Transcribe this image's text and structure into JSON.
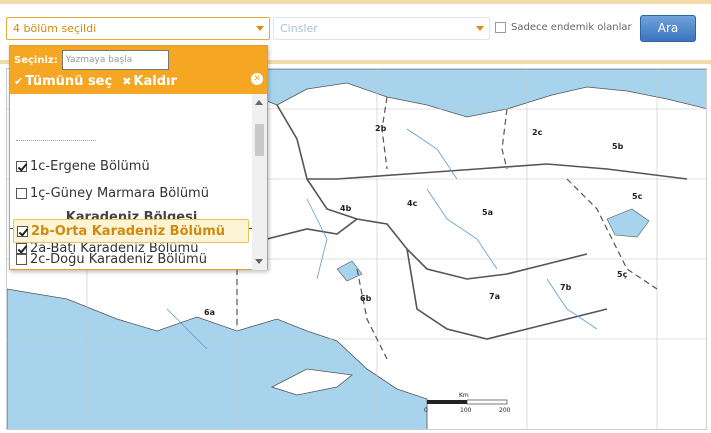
{
  "filters": {
    "bolum_select_value": "4 bölüm seçildi",
    "cinsler_select_value": "Cinsler",
    "endemic_label": "Sadece endemik olanlar",
    "search_button": "Ara"
  },
  "dropdown": {
    "label": "Seçiniz:",
    "search_placeholder": "Yazmaya başla",
    "select_all": "Tümünü seç",
    "select_all_glyph": "✔",
    "remove": "Kaldır",
    "remove_glyph": "✖",
    "clear_glyph": "✕",
    "options": [
      {
        "label": "1c-Ergene Bölümü",
        "checked": true
      },
      {
        "label": "1ç-Güney Marmara Bölümü",
        "checked": false
      }
    ],
    "group": "Karadeniz Bölgesi",
    "group_options": [
      {
        "label": "2a-Batı Karadeniz Bölümü",
        "checked": true
      },
      {
        "label": "2b-Orta Karadeniz Bölümü",
        "checked": true,
        "highlighted": true
      },
      {
        "label": "2c-Doğu Karadeniz Bölümü",
        "checked": false
      }
    ]
  },
  "map": {
    "region_labels": [
      "2b",
      "2c",
      "5b",
      "4b",
      "4c",
      "5a",
      "5c",
      "6a",
      "6b",
      "7a",
      "7b",
      "5ç"
    ],
    "scale_label": "Km",
    "scale_ticks": [
      "0",
      "100",
      "200"
    ],
    "sea_color": "#a7d4ec",
    "land_color": "#ffffff"
  }
}
